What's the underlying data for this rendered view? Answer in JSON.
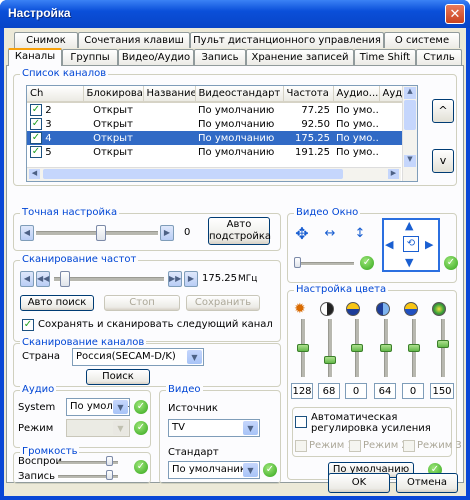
{
  "window": {
    "title": "Настройка",
    "close": "✕"
  },
  "tabs_row1": [
    "Снимок",
    "Сочетания клавиш",
    "Пульт дистанционного управления",
    "О системе"
  ],
  "tabs_row2": [
    "Каналы",
    "Группы",
    "Видео/Аудио",
    "Запись",
    "Хранение записей",
    "Time Shift",
    "Стиль"
  ],
  "channels": {
    "title": "Список каналов",
    "columns": [
      "Ch",
      "Блокирова...",
      "Название",
      "Видеостандарт",
      "Частота",
      "Аудио...",
      "Ауди"
    ],
    "rows": [
      {
        "ch": "2",
        "lock": "Открыт",
        "name": "",
        "std": "По умолчанию",
        "freq": "77.25",
        "audio": "По умо...",
        "audio2": ""
      },
      {
        "ch": "3",
        "lock": "Открыт",
        "name": "",
        "std": "По умолчанию",
        "freq": "92.50",
        "audio": "По умо...",
        "audio2": ""
      },
      {
        "ch": "4",
        "lock": "Открыт",
        "name": "",
        "std": "По умолчанию",
        "freq": "175.25",
        "audio": "По умо...",
        "audio2": ""
      },
      {
        "ch": "5",
        "lock": "Открыт",
        "name": "",
        "std": "По умолчанию",
        "freq": "191.25",
        "audio": "По умо...",
        "audio2": ""
      }
    ],
    "up": "^",
    "down": "v"
  },
  "fine": {
    "title": "Точная настройка",
    "value": "0",
    "auto": "Авто подстройка"
  },
  "scan_freq": {
    "title": "Сканирование частот",
    "freq": "175.25",
    "unit": "МГц",
    "auto": "Авто поиск",
    "stop": "Стоп",
    "save": "Сохранить",
    "save_scan": "Сохранять и сканировать следующий канал"
  },
  "scan_ch": {
    "title": "Сканирование каналов",
    "country_label": "Страна",
    "country": "Россия(SECAM-D/K)",
    "search": "Поиск"
  },
  "audio": {
    "title": "Аудио",
    "system_label": "System",
    "system": "По умолчани",
    "mode_label": "Режим",
    "mode": ""
  },
  "video": {
    "title": "Видео",
    "source_label": "Источник",
    "source": "TV",
    "std_label": "Стандарт",
    "std": "По умолчаник"
  },
  "volume": {
    "title": "Громкость",
    "play": "Воспрои",
    "rec": "Запись"
  },
  "video_window": {
    "title": "Видео Окно"
  },
  "color": {
    "title": "Настройка цвета",
    "values": [
      "128",
      "68",
      "0",
      "64",
      "0",
      "150"
    ],
    "levels": [
      0.5,
      0.27,
      0.5,
      0.5,
      0.5,
      0.59
    ]
  },
  "agc": {
    "label": "Автоматическая регулировка усиления",
    "modes": [
      "Режим 1",
      "Режим 2",
      "Режим 3"
    ],
    "default": "По умолчанию"
  },
  "buttons": {
    "ok": "OK",
    "cancel": "Отмена"
  },
  "colors": {
    "accent": "#0046d5",
    "selection": "#316ac5",
    "titlebar": "#0a4fd9"
  }
}
